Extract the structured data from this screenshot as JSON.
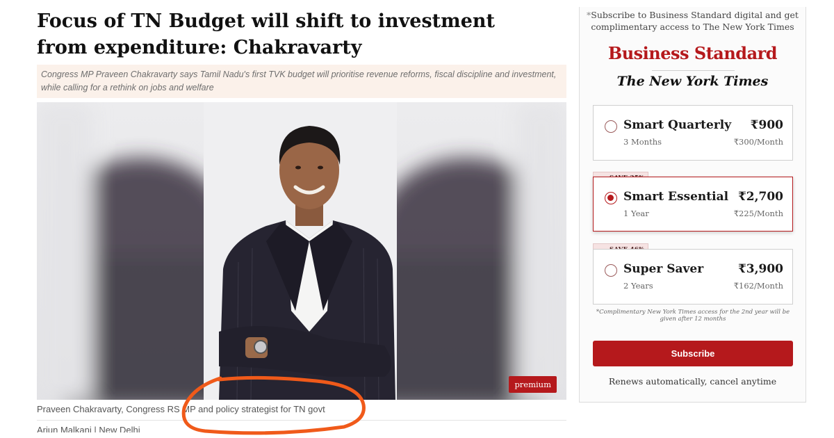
{
  "article": {
    "headline": "Focus of TN Budget will shift to investment from expenditure: Chakravarty",
    "summary": "Congress MP Praveen Chakravarty says Tamil Nadu's first TVK budget will prioritise revenue reforms, fiscal discipline and investment, while calling for a rethink on jobs and welfare",
    "premium_label": "premium",
    "caption": "Praveen Chakravarty, Congress RS MP and policy strategist for TN govt",
    "byline": "Arjun Malkani | New Delhi"
  },
  "subscribe": {
    "promo_star": "*",
    "promo_text": "Subscribe to Business Standard digital and get complimentary access to The New York Times",
    "logo_business_standard": "Business Standard",
    "logo_nyt": "The New York Times",
    "plans": [
      {
        "name": "Smart Quarterly",
        "price": "₹900",
        "term": "3 Months",
        "monthly": "₹300/Month",
        "save": "",
        "selected": false
      },
      {
        "name": "Smart Essential",
        "price": "₹2,700",
        "term": "1 Year",
        "monthly": "₹225/Month",
        "save": "SAVE 25%",
        "selected": true
      },
      {
        "name": "Super Saver",
        "price": "₹3,900",
        "term": "2 Years",
        "monthly": "₹162/Month",
        "save": "SAVE 46%",
        "selected": false
      }
    ],
    "footnote": "*Complimentary New York Times access for the 2nd year will be given after 12 months",
    "button_label": "Subscribe",
    "renews_text": "Renews automatically, cancel anytime"
  },
  "colors": {
    "accent_red": "#b5191c",
    "annotation_orange": "#f05a1a",
    "summary_bg": "#fbf1ea"
  }
}
